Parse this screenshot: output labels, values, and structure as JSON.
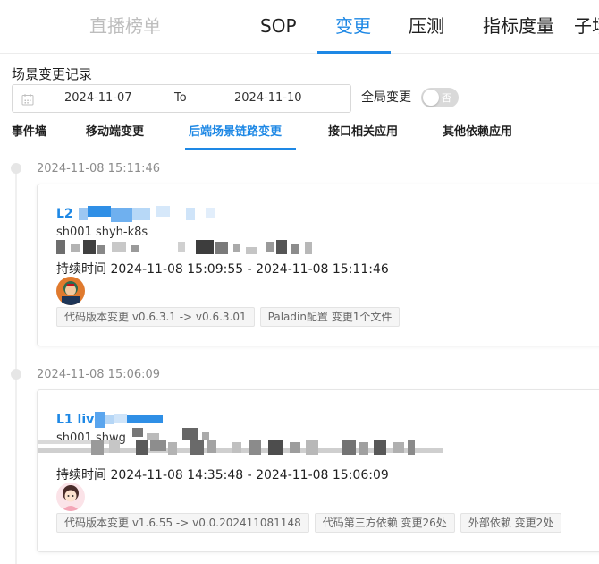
{
  "nav": {
    "items": [
      {
        "label": "直播榜单",
        "state": "dim"
      },
      {
        "label": "SOP",
        "state": "normal"
      },
      {
        "label": "变更",
        "state": "active"
      },
      {
        "label": "压测",
        "state": "normal"
      },
      {
        "label": "指标度量",
        "state": "normal"
      },
      {
        "label": "子场",
        "state": "normal"
      }
    ]
  },
  "section": {
    "title": "场景变更记录"
  },
  "date_range": {
    "start": "2024-11-07",
    "separator": "To",
    "end": "2024-11-10"
  },
  "global_toggle": {
    "label": "全局变更",
    "state_text": "否",
    "on": false
  },
  "subtabs": [
    {
      "label": "事件墙"
    },
    {
      "label": "移动端变更"
    },
    {
      "label": "后端场景链路变更",
      "active": true
    },
    {
      "label": "接口相关应用"
    },
    {
      "label": "其他依赖应用"
    }
  ],
  "events": [
    {
      "time": "2024-11-08 15:11:46",
      "title": "L2",
      "subtitle": "sh001 shyh-k8s",
      "duration": "持续时间 2024-11-08 15:09:55 - 2024-11-08 15:11:46",
      "tags": [
        "代码版本变更 v0.6.3.1 -> v0.6.3.01",
        "Paladin配置 变更1个文件"
      ]
    },
    {
      "time": "2024-11-08 15:06:09",
      "title": "L1 live",
      "subtitle": "sh001 shwg",
      "duration": "持续时间 2024-11-08 14:35:48 - 2024-11-08 15:06:09",
      "tags": [
        "代码版本变更 v1.6.55 -> v0.0.202411081148",
        "代码第三方依赖 变更26处",
        "外部依赖 变更2处"
      ]
    }
  ],
  "colors": {
    "accent": "#1e88e5",
    "muted": "#8c8c8c",
    "border": "#e6e6e6"
  }
}
